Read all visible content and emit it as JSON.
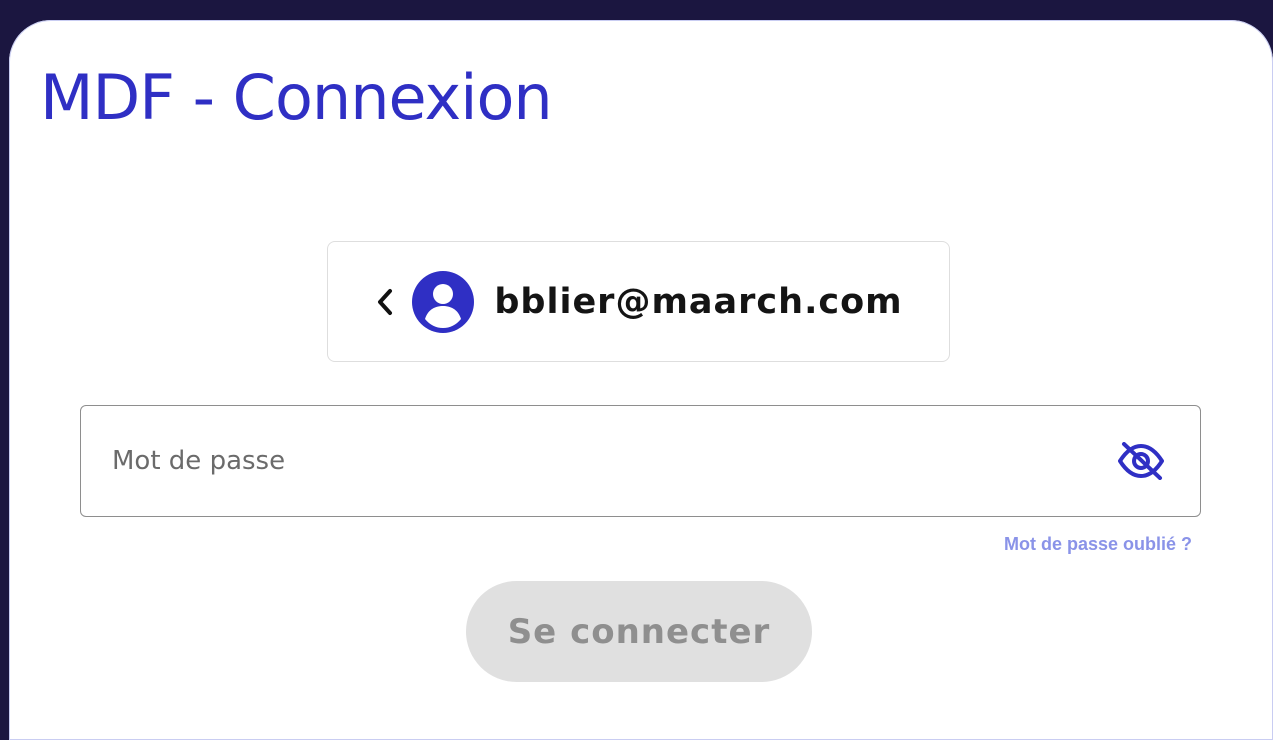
{
  "header": {
    "title": "MDF - Connexion"
  },
  "account": {
    "email": "bblier@maarch.com",
    "back_icon": "chevron-left-icon",
    "avatar_icon": "account-circle-icon"
  },
  "password": {
    "placeholder": "Mot de passe",
    "value": "",
    "toggle_icon": "eye-off-icon"
  },
  "links": {
    "forgot_password": "Mot de passe oublié ?"
  },
  "actions": {
    "login_label": "Se connecter",
    "login_enabled": false
  },
  "colors": {
    "accent": "#2f2fc4",
    "link": "#8a93e8",
    "background": "#1b1640",
    "button_disabled_bg": "#e0e0e0",
    "button_disabled_text": "#8f8f8f"
  }
}
